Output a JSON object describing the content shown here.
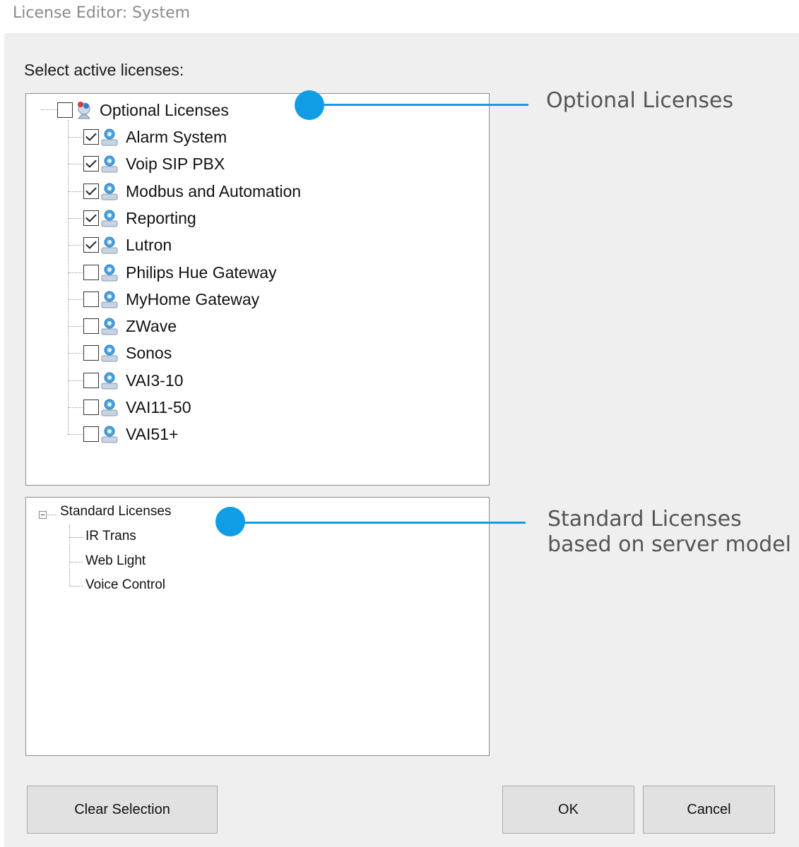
{
  "window": {
    "title": "License Editor: System"
  },
  "dialog": {
    "prompt": "Select active licenses:"
  },
  "optional": {
    "root": {
      "label": "Optional Licenses",
      "checked": false
    },
    "items": [
      {
        "label": "Alarm System",
        "checked": true
      },
      {
        "label": "Voip SIP PBX",
        "checked": true
      },
      {
        "label": "Modbus and Automation",
        "checked": true
      },
      {
        "label": "Reporting",
        "checked": true
      },
      {
        "label": "Lutron",
        "checked": true
      },
      {
        "label": "Philips Hue Gateway",
        "checked": false
      },
      {
        "label": "MyHome Gateway",
        "checked": false
      },
      {
        "label": "ZWave",
        "checked": false
      },
      {
        "label": "Sonos",
        "checked": false
      },
      {
        "label": "VAI3-10",
        "checked": false
      },
      {
        "label": "VAI11-50",
        "checked": false
      },
      {
        "label": "VAI51+",
        "checked": false
      }
    ]
  },
  "standard": {
    "root": {
      "label": "Standard Licenses",
      "expanded": true
    },
    "items": [
      {
        "label": "IR Trans"
      },
      {
        "label": "Web Light"
      },
      {
        "label": "Voice Control"
      }
    ]
  },
  "callouts": {
    "optional": {
      "label": "Optional Licenses"
    },
    "standard": {
      "line1": "Standard Licenses",
      "line2": "based on server model"
    },
    "color": "#119ce6"
  },
  "buttons": {
    "clear": "Clear Selection",
    "ok": "OK",
    "cancel": "Cancel"
  },
  "icons": {
    "license_item": "license-user-icon",
    "license_root": "license-group-icon"
  }
}
